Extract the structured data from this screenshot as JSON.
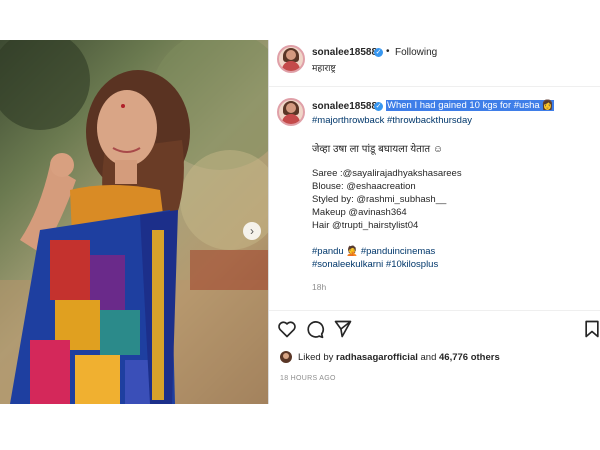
{
  "header": {
    "username": "sonalee18588",
    "follow_status": "Following",
    "separator": "•",
    "location": "महाराष्ट्र",
    "more": "•••"
  },
  "caption": {
    "username": "sonalee18588",
    "highlighted_text": "When I had gained 10 kgs for #usha",
    "highlight_emoji": "👩",
    "hashtags_1": "#majorthrowback #throwbackthursday",
    "marathi_line": "जेव्हा उषा ला पांडू बघायला येतात ☺",
    "credits": [
      "Saree :@sayalirajadhyakshasarees",
      "Blouse: @eshaacreation",
      "Styled by: @rashmi_subhash__",
      "Makeup @avinash364",
      "Hair @trupti_hairstylist04"
    ],
    "hashtags_2_a": "#pandu",
    "hashtags_2_emoji": "🤦",
    "hashtags_2_b": "#panduincinemas",
    "hashtags_3": "#sonaleekulkarni #10kilosplus",
    "time": "18h"
  },
  "actions": {
    "liked_prefix": "Liked by",
    "liked_user": "radhasagarofficial",
    "liked_mid": "and",
    "liked_count": "46,776 others",
    "posted_ago": "18 HOURS AGO"
  },
  "icons": {
    "like": "heart-icon",
    "comment": "comment-icon",
    "share": "paper-plane-icon",
    "save": "bookmark-icon",
    "next": "chevron-right-icon",
    "verified": "verified-badge-icon"
  },
  "colors": {
    "highlight": "#3f7ee8",
    "hashtag": "#00376b",
    "verified": "#3897f0",
    "muted": "#8e8e8e"
  }
}
